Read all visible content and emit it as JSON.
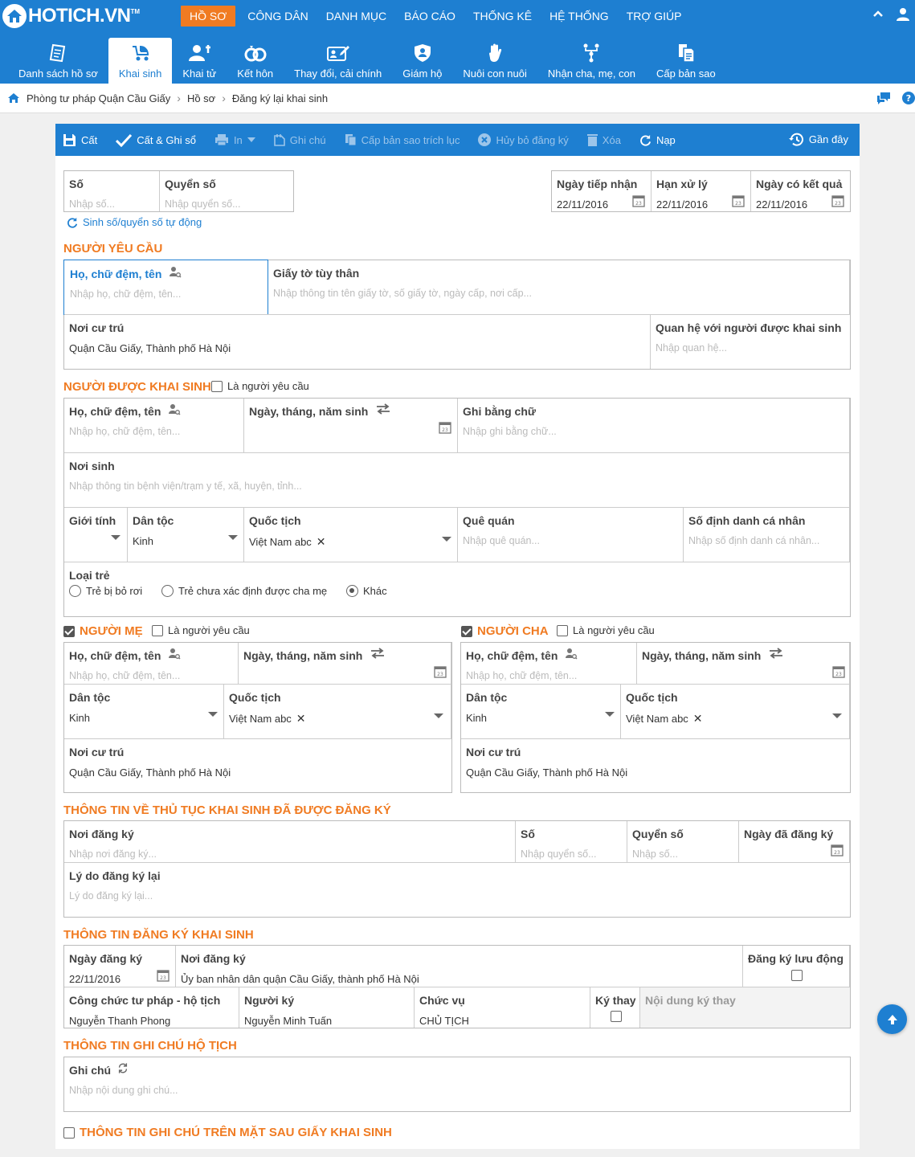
{
  "app": {
    "logo": "HOTICH.VN",
    "tm": "TM"
  },
  "menu": [
    "HỒ SƠ",
    "CÔNG DÂN",
    "DANH MỤC",
    "BÁO CÁO",
    "THỐNG KÊ",
    "HỆ THỐNG",
    "TRỢ GIÚP"
  ],
  "tabs": [
    "Danh sách hồ sơ",
    "Khai sinh",
    "Khai tử",
    "Kết hôn",
    "Thay đổi, cải chính",
    "Giám hộ",
    "Nuôi con nuôi",
    "Nhận cha, mẹ, con",
    "Cấp bản sao"
  ],
  "breadcrumb": [
    "Phòng tư pháp Quận Cầu Giấy",
    "Hồ sơ",
    "Đăng ký lại khai sinh"
  ],
  "toolbar": {
    "save": "Cất",
    "save_sign": "Cất & Ghi sổ",
    "print": "In",
    "note": "Ghi chú",
    "copy": "Cấp bản sao trích lục",
    "cancel": "Hủy bỏ đăng ký",
    "delete": "Xóa",
    "reload": "Nạp",
    "recent": "Gần đây"
  },
  "header": {
    "so_label": "Số",
    "so_ph": "Nhập số...",
    "quyen_label": "Quyển số",
    "quyen_ph": "Nhập quyển số...",
    "auto": "Sinh số/quyển số tự động",
    "ngay_tiep_nhan_label": "Ngày tiếp nhận",
    "ngay_tiep_nhan": "22/11/2016",
    "han_label": "Hạn xử lý",
    "han": "22/11/2016",
    "ngay_kq_label": "Ngày có kết quả",
    "ngay_kq": "22/11/2016"
  },
  "requester": {
    "title": "NGƯỜI YÊU CẦU",
    "name_label": "Họ, chữ đệm, tên",
    "name_ph": "Nhập họ, chữ đệm, tên...",
    "id_label": "Giấy tờ tùy thân",
    "id_ph": "Nhập thông tin tên giấy tờ, số giấy tờ, ngày cấp, nơi cấp...",
    "addr_label": "Nơi cư trú",
    "addr": "Quận Cầu Giấy, Thành phố Hà Nội",
    "rel_label": "Quan hệ với người được khai sinh",
    "rel_ph": "Nhập quan hệ..."
  },
  "child": {
    "title": "NGƯỜI ĐƯỢC KHAI SINH",
    "is_req": "Là người yêu cầu",
    "name_label": "Họ, chữ đệm, tên",
    "name_ph": "Nhập họ, chữ đệm, tên...",
    "dob_label": "Ngày, tháng, năm sinh",
    "words_label": "Ghi bằng chữ",
    "words_ph": "Nhập ghi bằng chữ...",
    "pob_label": "Nơi sinh",
    "pob_ph": "Nhập thông tin bệnh viện/trạm y tế, xã, huyện, tỉnh...",
    "sex_label": "Giới tính",
    "eth_label": "Dân tộc",
    "eth": "Kinh",
    "nat_label": "Quốc tịch",
    "nat": "Việt Nam abc",
    "home_label": "Quê quán",
    "home_ph": "Nhập quê quán...",
    "pid_label": "Số định danh cá nhân",
    "pid_ph": "Nhập số định danh cá nhân...",
    "type_label": "Loại trẻ",
    "type_opts": [
      "Trẻ bị bỏ rơi",
      "Trẻ chưa xác định được cha mẹ",
      "Khác"
    ]
  },
  "mother": {
    "title": "NGƯỜI MẸ",
    "is_req": "Là người yêu cầu",
    "name_label": "Họ, chữ đệm, tên",
    "name_ph": "Nhập họ, chữ đệm, tên...",
    "dob_label": "Ngày, tháng, năm sinh",
    "eth_label": "Dân tộc",
    "eth": "Kinh",
    "nat_label": "Quốc tịch",
    "nat": "Việt Nam abc",
    "addr_label": "Nơi cư trú",
    "addr": "Quận Cầu Giấy, Thành phố Hà Nội"
  },
  "father": {
    "title": "NGƯỜI CHA",
    "is_req": "Là người yêu cầu",
    "name_label": "Họ, chữ đệm, tên",
    "name_ph": "Nhập họ, chữ đệm, tên...",
    "dob_label": "Ngày, tháng, năm sinh",
    "eth_label": "Dân tộc",
    "eth": "Kinh",
    "nat_label": "Quốc tịch",
    "nat": "Việt Nam abc",
    "addr_label": "Nơi cư trú",
    "addr": "Quận Cầu Giấy, Thành phố Hà Nội"
  },
  "prior": {
    "title": "THÔNG TIN VỀ THỦ TỤC KHAI SINH ĐÃ ĐƯỢC ĐĂNG KÝ",
    "place_label": "Nơi đăng ký",
    "place_ph": "Nhập nơi đăng ký...",
    "so_label": "Số",
    "so_ph": "Nhập quyển số...",
    "quyen_label": "Quyển số",
    "quyen_ph": "Nhập số...",
    "date_label": "Ngày đã đăng ký",
    "reason_label": "Lý do đăng ký lại",
    "reason_ph": "Lý do đăng ký lại..."
  },
  "reg": {
    "title": "THÔNG TIN ĐĂNG KÝ KHAI SINH",
    "date_label": "Ngày đăng ký",
    "date": "22/11/2016",
    "place_label": "Nơi đăng ký",
    "place": "Ủy ban nhân dân quận Cầu Giấy, thành phố Hà Nội",
    "mobile_label": "Đăng ký lưu động",
    "officer_label": "Công chức tư pháp - hộ tịch",
    "officer": "Nguyễn Thanh Phong",
    "signer_label": "Người ký",
    "signer": "Nguyễn Minh Tuấn",
    "pos_label": "Chức vụ",
    "pos": "CHỦ TỊCH",
    "proxy_label": "Ký thay",
    "proxy_content_label": "Nội dung ký thay"
  },
  "notes": {
    "title": "THÔNG TIN GHI CHÚ HỘ TỊCH",
    "label": "Ghi chú",
    "ph": "Nhập nội dung ghi chú...",
    "back_title": "THÔNG TIN GHI CHÚ TRÊN MẶT SAU GIẤY KHAI SINH"
  },
  "colors": {
    "primary": "#1e7fd1",
    "accent": "#f07b22"
  }
}
